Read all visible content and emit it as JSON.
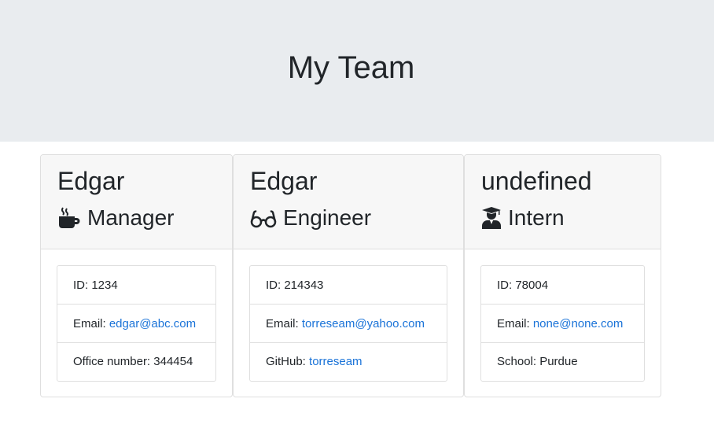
{
  "header": {
    "title": "My Team"
  },
  "cards": [
    {
      "name": "Edgar",
      "role": "Manager",
      "icon": "coffee-icon",
      "id_label": "ID: ",
      "id": "1234",
      "email_label": "Email: ",
      "email": "edgar@abc.com",
      "extra_label": "Office number: ",
      "extra": "344454"
    },
    {
      "name": "Edgar",
      "role": "Engineer",
      "icon": "glasses-icon",
      "id_label": "ID: ",
      "id": "214343",
      "email_label": "Email: ",
      "email": "torreseam@yahoo.com",
      "extra_label": "GitHub: ",
      "extra": "torreseam"
    },
    {
      "name": "undefined",
      "role": "Intern",
      "icon": "graduate-icon",
      "id_label": "ID: ",
      "id": "78004",
      "email_label": "Email: ",
      "email": "none@none.com",
      "extra_label": "School: ",
      "extra": "Purdue"
    }
  ],
  "colors": {
    "link": "#1a73d8",
    "jumbotron": "#e9ecef",
    "card_header": "#f7f7f7"
  }
}
